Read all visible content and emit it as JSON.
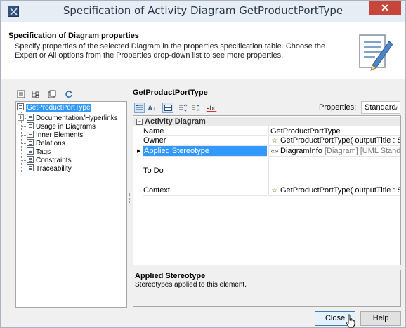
{
  "window": {
    "title": "Specification of Activity Diagram GetProductPortType",
    "close_glyph": "✕"
  },
  "header": {
    "title": "Specification of Diagram properties",
    "description": "Specify properties of the selected Diagram in the properties specification table. Choose the Expert or All options from the Properties drop-down list to see more properties."
  },
  "tree": {
    "root": "GetProductPortType",
    "items": [
      "Documentation/Hyperlinks",
      "Usage in Diagrams",
      "Inner Elements",
      "Relations",
      "Tags",
      "Constraints",
      "Traceability"
    ]
  },
  "left_toolbar": {
    "icons": [
      "flat-list-icon",
      "tree-view-icon",
      "collapse-icon",
      "refresh-icon"
    ]
  },
  "right": {
    "title": "GetProductPortType",
    "toolbar": {
      "sort_glyph": "A↓",
      "spell_glyph": "abc",
      "properties_label": "Properties:",
      "properties_value": "Standard"
    },
    "group": "Activity Diagram",
    "rows": [
      {
        "key": "Name",
        "value": "GetProductPortType",
        "value_extra": ""
      },
      {
        "key": "Owner",
        "value": "GetProductPortType( outputTitle : Stri...",
        "value_extra": ""
      },
      {
        "key": "Applied Stereotype",
        "value": "DiagramInfo",
        "value_extra": " [Diagram] [UML Standard P"
      },
      {
        "key": "To Do",
        "value": "",
        "value_extra": ""
      },
      {
        "key": "Context",
        "value": "GetProductPortType( outputTitle : Stri...",
        "value_extra": ""
      }
    ],
    "stereo_glyph": "«»"
  },
  "description_box": {
    "title": "Applied Stereotype",
    "text": "Stereotypes applied to this element."
  },
  "buttons": {
    "close": "Close",
    "help": "Help"
  },
  "colors": {
    "selection": "#3399ff",
    "close_button": "#c7463c"
  }
}
